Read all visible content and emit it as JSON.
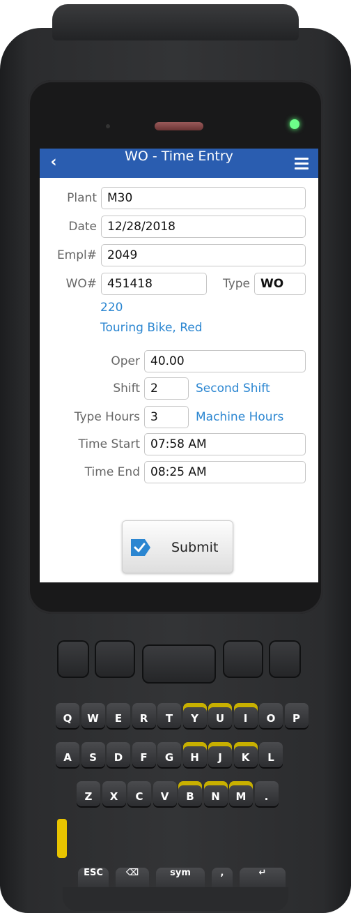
{
  "app": {
    "title": "WO - Time Entry",
    "back_icon": "chevron-left-icon",
    "menu_icon": "hamburger-menu-icon"
  },
  "form": {
    "plant": {
      "label": "Plant",
      "value": "M30"
    },
    "date": {
      "label": "Date",
      "value": "12/28/2018"
    },
    "empl": {
      "label": "Empl#",
      "value": "2049"
    },
    "wo": {
      "label": "WO#",
      "value": "451418"
    },
    "type": {
      "label": "Type",
      "value": "WO"
    },
    "item_number": "220",
    "item_desc": "Touring Bike, Red",
    "oper": {
      "label": "Oper",
      "value": "40.00"
    },
    "shift": {
      "label": "Shift",
      "value": "2",
      "desc": "Second Shift"
    },
    "type_hours": {
      "label": "Type Hours",
      "value": "3",
      "desc": "Machine Hours"
    },
    "time_start": {
      "label": "Time Start",
      "value": "07:58 AM"
    },
    "time_end": {
      "label": "Time End",
      "value": "08:25 AM"
    }
  },
  "submit": {
    "label": "Submit",
    "icon": "checkmark-icon"
  },
  "colors": {
    "titlebar": "#2a5db0",
    "accent_text": "#2b86d1",
    "led": "#6dff8a",
    "fn_yellow": "#e8c400"
  },
  "keypad": {
    "rows": [
      [
        "Q",
        "W",
        "E",
        "R",
        "T",
        "Y",
        "U",
        "I",
        "O",
        "P"
      ],
      [
        "A",
        "S",
        "D",
        "F",
        "G",
        "H",
        "J",
        "K",
        "L"
      ],
      [
        "Z",
        "X",
        "C",
        "V",
        "B",
        "N",
        "M",
        "."
      ]
    ],
    "esc": "ESC",
    "sym": "sym"
  }
}
